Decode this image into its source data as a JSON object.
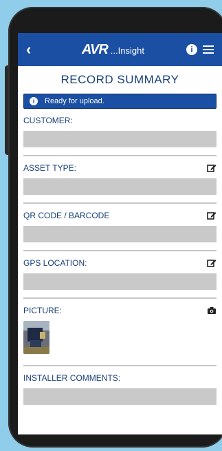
{
  "app": {
    "logo": "AVR",
    "tagline": "...Insight",
    "back_label": "‹"
  },
  "page": {
    "title": "RECORD SUMMARY",
    "banner": "Ready for upload."
  },
  "sections": {
    "customer": {
      "label": "CUSTOMER:",
      "value": ""
    },
    "asset_type": {
      "label": "ASSET TYPE:",
      "value": ""
    },
    "qr_code": {
      "label": "QR CODE / BARCODE",
      "value": ""
    },
    "gps": {
      "label": "GPS LOCATION:",
      "value": ""
    },
    "picture": {
      "label": "PICTURE:"
    },
    "installer_comments": {
      "label": "INSTALLER COMMENTS:",
      "value": ""
    }
  },
  "colors": {
    "accent": "#1a4fa3",
    "label": "#1a3f7a",
    "field_bg": "#c9c9c9",
    "page_bg": "#8fcdea"
  },
  "icons": {
    "edit": "edit-icon",
    "camera": "camera-icon",
    "info": "info-icon",
    "menu": "hamburger-menu-icon"
  }
}
